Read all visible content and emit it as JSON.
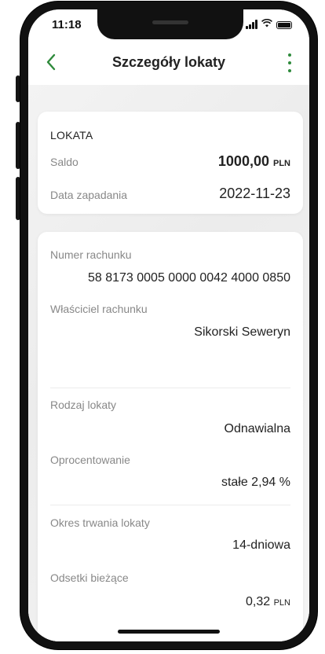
{
  "status_bar": {
    "time": "11:18",
    "icons": [
      "signal-icon",
      "wifi-icon",
      "battery-icon"
    ]
  },
  "header": {
    "title": "Szczegóły lokaty",
    "back_icon": "chevron-left-icon",
    "menu_icon": "more-vertical-icon",
    "accent_color": "#2e8a3b"
  },
  "summary": {
    "heading": "LOKATA",
    "balance_label": "Saldo",
    "balance_amount": "1000,00",
    "balance_currency": "PLN",
    "maturity_label": "Data zapadania",
    "maturity_value": "2022-11-23"
  },
  "details": {
    "account_number_label": "Numer rachunku",
    "account_number_value": "58 8173 0005 0000 0042 4000 0850",
    "owner_label": "Właściciel rachunku",
    "owner_value": "Sikorski Seweryn",
    "type_label": "Rodzaj lokaty",
    "type_value": "Odnawialna",
    "interest_label": "Oprocentowanie",
    "interest_value": "stałe 2,94 %",
    "term_label": "Okres trwania lokaty",
    "term_value": "14-dniowa",
    "current_interest_label": "Odsetki bieżące",
    "current_interest_amount": "0,32",
    "current_interest_currency": "PLN"
  }
}
